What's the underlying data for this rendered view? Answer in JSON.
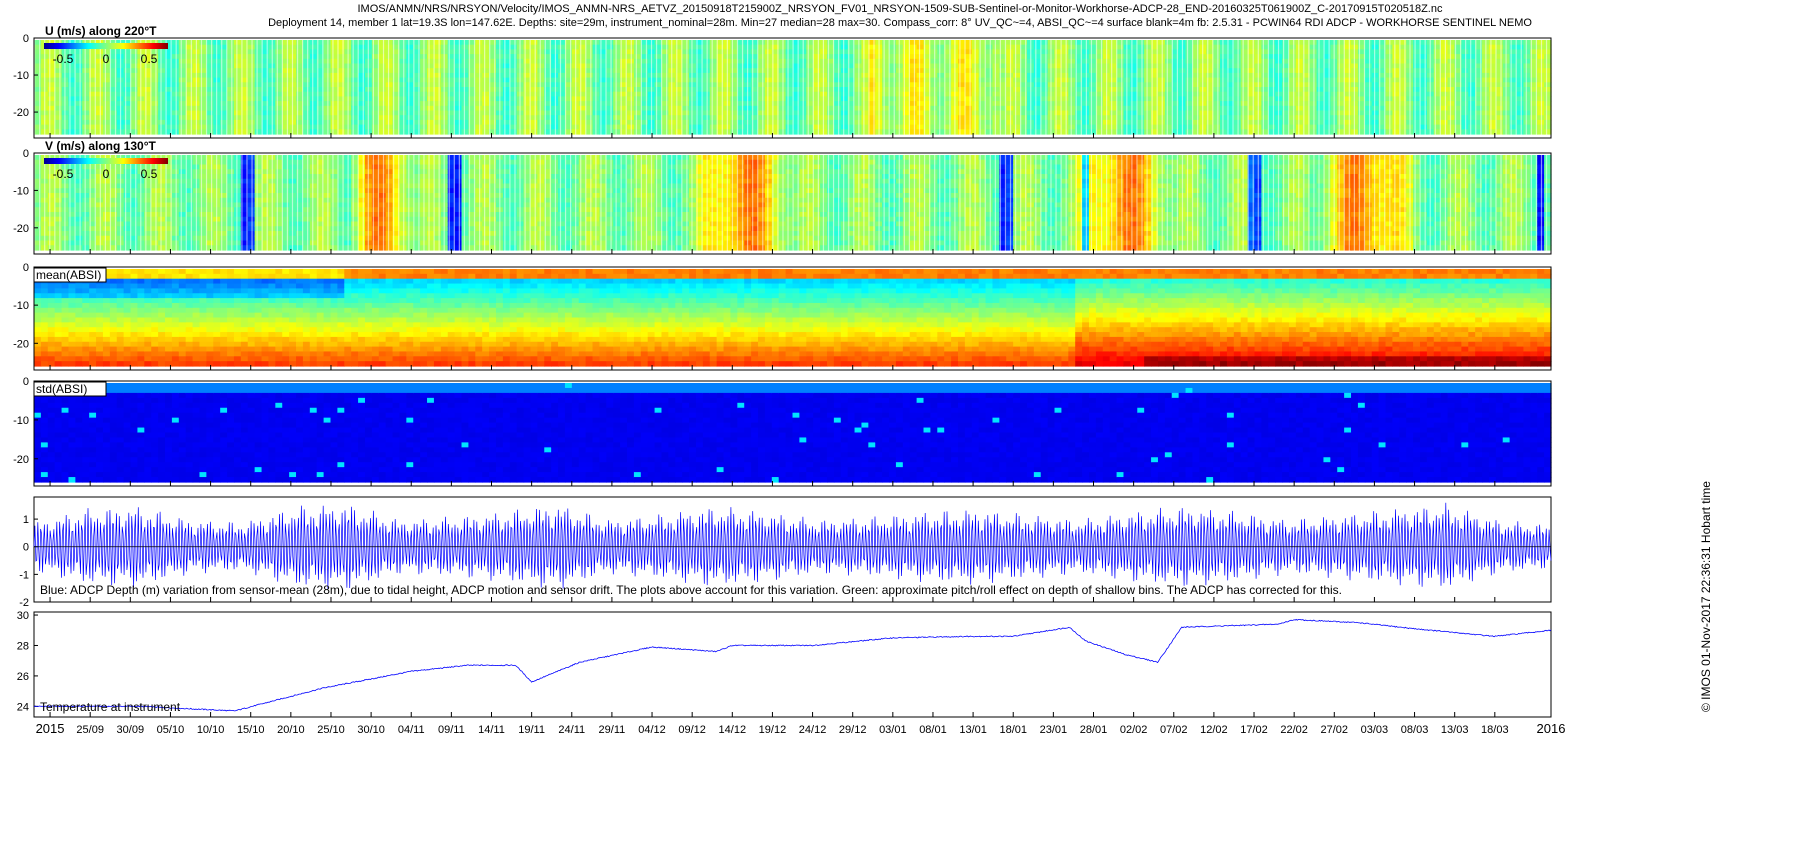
{
  "header": {
    "line1": "IMOS/ANMN/NRS/NRSYON/Velocity/IMOS_ANMN-NRS_AETVZ_20150918T215900Z_NRSYON_FV01_NRSYON-1509-SUB-Sentinel-or-Monitor-Workhorse-ADCP-28_END-20160325T061900Z_C-20170915T020518Z.nc",
    "line2": "Deployment 14, member 1 lat=19.3S lon=147.62E. Depths: site=29m, instrument_nominal=28m. Min=27 median=28 max=30. Compass_corr: 8° UV_QC~=4, ABSI_QC~=4 surface blank=4m fb: 2.5.31 - PCWIN64 RDI ADCP - WORKHORSE SENTINEL NEMO"
  },
  "footer": {
    "credit": "© IMOS 01-Nov-2017 22:36:31 Hobart time"
  },
  "colors": {
    "line": "#0000ff",
    "frame": "#000000",
    "deep_blue": "#00008f"
  },
  "chart_data": [
    {
      "type": "heatmap",
      "label": "U (m/s) along 220°T",
      "ylabel_ticks": [
        "0",
        "-10",
        "-20"
      ],
      "ylim": [
        -27,
        0
      ],
      "colorbar_ticks": [
        "-0.5",
        "0",
        "0.5"
      ],
      "clim": [
        -0.7,
        0.7
      ],
      "character": "mostly near zero (green), weak tidal banding"
    },
    {
      "type": "heatmap",
      "label": "V (m/s) along 130°T",
      "ylabel_ticks": [
        "0",
        "-10",
        "-20"
      ],
      "ylim": [
        -27,
        0
      ],
      "colorbar_ticks": [
        "-0.5",
        "0",
        "0.5"
      ],
      "clim": [
        -0.7,
        0.7
      ],
      "character": "episodes of positive flow (orange/red) late Oct, Dec-Jan, mid Feb"
    },
    {
      "type": "heatmap",
      "label": "mean(ABSI)",
      "ylabel_ticks": [
        "0",
        "-10",
        "-20"
      ],
      "ylim": [
        -27,
        0
      ],
      "character": "blue near surface, green-yellow at depth, stronger near bottom from Feb"
    },
    {
      "type": "heatmap",
      "label": "std(ABSI)",
      "ylabel_ticks": [
        "0",
        "-10",
        "-20"
      ],
      "ylim": [
        -27,
        0
      ],
      "character": "mostly dark blue, sparse streaks"
    },
    {
      "type": "line",
      "label": "Blue: ADCP Depth (m) variation from sensor-mean (28m), due to tidal height, ADCP motion and sensor drift. The plots above account for this variation. Green: approximate pitch/roll effect on depth of shallow bins. The ADCP has corrected for this.",
      "ylim": [
        -2,
        1.8
      ],
      "yticks": [
        "1",
        "0",
        "-1",
        "-2"
      ],
      "series": [
        {
          "envelope_amplitude_m": [
            0.9,
            1.4,
            1.5,
            1.0,
            0.9,
            1.5,
            1.6,
            1.0,
            1.1,
            1.3,
            1.6,
            1.0,
            1.2,
            1.5,
            1.3,
            1.0,
            1.1,
            1.3,
            1.4,
            1.2,
            1.0,
            1.3,
            1.5,
            1.3,
            1.0,
            1.2,
            1.4,
            1.6,
            1.0,
            0.8
          ]
        }
      ]
    },
    {
      "type": "line",
      "label": "Temperature at instrument",
      "ylim": [
        23.3,
        30.2
      ],
      "yticks": [
        "30",
        "28",
        "26",
        "24"
      ],
      "x": [
        "2015-09-19",
        "2015-10-01",
        "2015-10-13",
        "2015-10-24",
        "2015-11-04",
        "2015-11-11",
        "2015-11-17",
        "2015-11-19",
        "2015-11-25",
        "2015-12-04",
        "2015-12-12",
        "2015-12-14",
        "2015-12-24",
        "2016-01-03",
        "2016-01-13",
        "2016-01-18",
        "2016-01-25",
        "2016-01-27",
        "2016-02-01",
        "2016-02-05",
        "2016-02-08",
        "2016-02-20",
        "2016-02-22",
        "2016-03-01",
        "2016-03-08",
        "2016-03-18",
        "2016-03-25"
      ],
      "series": [
        {
          "values": [
            24.0,
            24.0,
            23.7,
            25.2,
            26.3,
            26.7,
            26.7,
            25.6,
            26.9,
            27.9,
            27.6,
            28.0,
            28.0,
            28.5,
            28.6,
            28.6,
            29.2,
            28.3,
            27.4,
            26.9,
            29.2,
            29.4,
            29.7,
            29.5,
            29.1,
            28.6,
            29.0
          ]
        }
      ]
    }
  ],
  "xaxis": {
    "start": "2015-09-18",
    "end": "2016-03-25",
    "ticks": [
      [
        "2015-09-20",
        "2015"
      ],
      [
        "2015-09-25",
        "25/09"
      ],
      [
        "2015-09-30",
        "30/09"
      ],
      [
        "2015-10-05",
        "05/10"
      ],
      [
        "2015-10-10",
        "10/10"
      ],
      [
        "2015-10-15",
        "15/10"
      ],
      [
        "2015-10-20",
        "20/10"
      ],
      [
        "2015-10-25",
        "25/10"
      ],
      [
        "2015-10-30",
        "30/10"
      ],
      [
        "2015-11-04",
        "04/11"
      ],
      [
        "2015-11-09",
        "09/11"
      ],
      [
        "2015-11-14",
        "14/11"
      ],
      [
        "2015-11-19",
        "19/11"
      ],
      [
        "2015-11-24",
        "24/11"
      ],
      [
        "2015-11-29",
        "29/11"
      ],
      [
        "2015-12-04",
        "04/12"
      ],
      [
        "2015-12-09",
        "09/12"
      ],
      [
        "2015-12-14",
        "14/12"
      ],
      [
        "2015-12-19",
        "19/12"
      ],
      [
        "2015-12-24",
        "24/12"
      ],
      [
        "2015-12-29",
        "29/12"
      ],
      [
        "2016-01-03",
        "03/01"
      ],
      [
        "2016-01-08",
        "08/01"
      ],
      [
        "2016-01-13",
        "13/01"
      ],
      [
        "2016-01-18",
        "18/01"
      ],
      [
        "2016-01-23",
        "23/01"
      ],
      [
        "2016-01-28",
        "28/01"
      ],
      [
        "2016-02-02",
        "02/02"
      ],
      [
        "2016-02-07",
        "07/02"
      ],
      [
        "2016-02-12",
        "12/02"
      ],
      [
        "2016-02-17",
        "17/02"
      ],
      [
        "2016-02-22",
        "22/02"
      ],
      [
        "2016-02-27",
        "27/02"
      ],
      [
        "2016-03-03",
        "03/03"
      ],
      [
        "2016-03-08",
        "08/03"
      ],
      [
        "2016-03-13",
        "13/03"
      ],
      [
        "2016-03-18",
        "18/03"
      ],
      [
        "2016-03-25",
        "2016"
      ]
    ]
  }
}
